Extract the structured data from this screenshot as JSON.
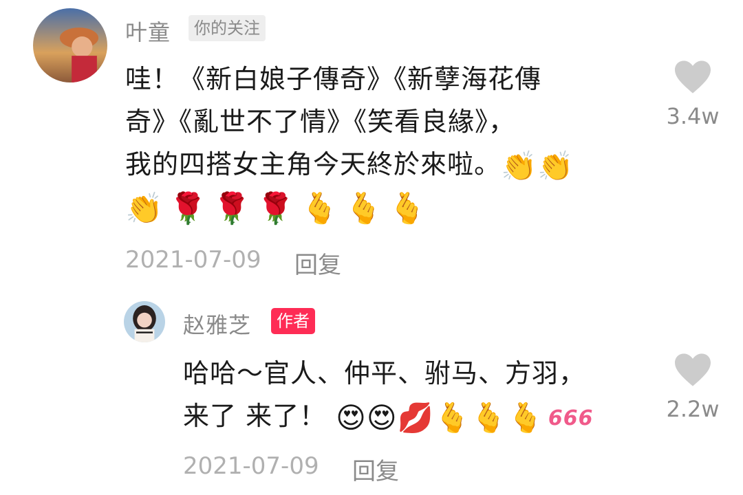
{
  "comments": [
    {
      "username": "叶童",
      "tag": "你的关注",
      "text_lines": [
        "哇！《新白娘子傳奇》《新孽海花傳",
        "奇》《亂世不了情》《笑看良緣》，",
        "我的四搭女主角今天終於來啦。"
      ],
      "line3_emoji": "👏👏",
      "emoji_line": [
        "👏",
        "🌹",
        "🌹",
        "🌹",
        "🫰",
        "🫰",
        "🫰"
      ],
      "date": "2021-07-09",
      "reply_label": "回复",
      "like_count": "3.4w",
      "icons": {
        "avatar": "avatar-photo",
        "like": "heart-icon"
      }
    },
    {
      "username": "赵雅芝",
      "tag": "作者",
      "text_lines": [
        "哈哈～官人、仲平、驸马、方羽，",
        "来了 来了！"
      ],
      "line2_emoji": "😍😍💋🫰🫰🫰",
      "line2_badge": "666",
      "date": "2021-07-09",
      "reply_label": "回复",
      "like_count": "2.2w",
      "icons": {
        "avatar": "avatar-photo",
        "like": "heart-icon"
      }
    }
  ],
  "colors": {
    "author_tag": "#fe2c55",
    "follow_tag_bg": "#eeeeee",
    "muted_text": "#8a8a8a",
    "like_heart": "#cccccc"
  }
}
